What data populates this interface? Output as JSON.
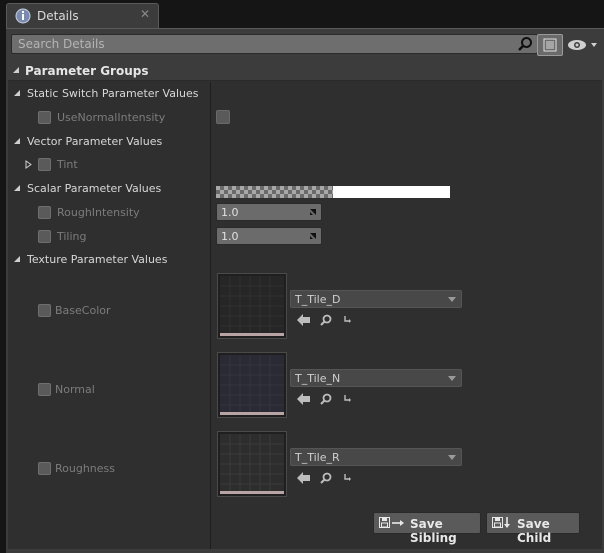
{
  "tab": {
    "title": "Details",
    "close": "✕"
  },
  "search": {
    "placeholder": "Search Details",
    "value": ""
  },
  "group": {
    "title": "Parameter Groups"
  },
  "categories": {
    "static_switch": "Static Switch Parameter Values",
    "vector": "Vector Parameter Values",
    "scalar": "Scalar Parameter Values",
    "texture": "Texture Parameter Values"
  },
  "params": {
    "use_normal_intensity": {
      "label": "UseNormalIntensity",
      "checked": false
    },
    "tint": {
      "label": "Tint",
      "color": "#ffffff"
    },
    "rough_intensity": {
      "label": "RoughIntensity",
      "value": "1.0"
    },
    "tiling": {
      "label": "Tiling",
      "value": "1.0"
    },
    "base_color": {
      "label": "BaseColor",
      "asset": "T_Tile_D"
    },
    "normal": {
      "label": "Normal",
      "asset": "T_Tile_N"
    },
    "roughness": {
      "label": "Roughness",
      "asset": "T_Tile_R"
    }
  },
  "buttons": {
    "save_sibling": "Save Sibling",
    "save_child": "Save Child"
  },
  "icons": {
    "tab": "info-icon",
    "search": "search-icon",
    "view": "view-options-icon",
    "eye": "eye-icon",
    "use_selected": "arrow-left-icon",
    "browse": "search-icon",
    "reset": "reset-icon"
  },
  "colors": {
    "panel": "#3c3c3c",
    "content": "#2f2f2f",
    "accent": "#ffffff"
  }
}
